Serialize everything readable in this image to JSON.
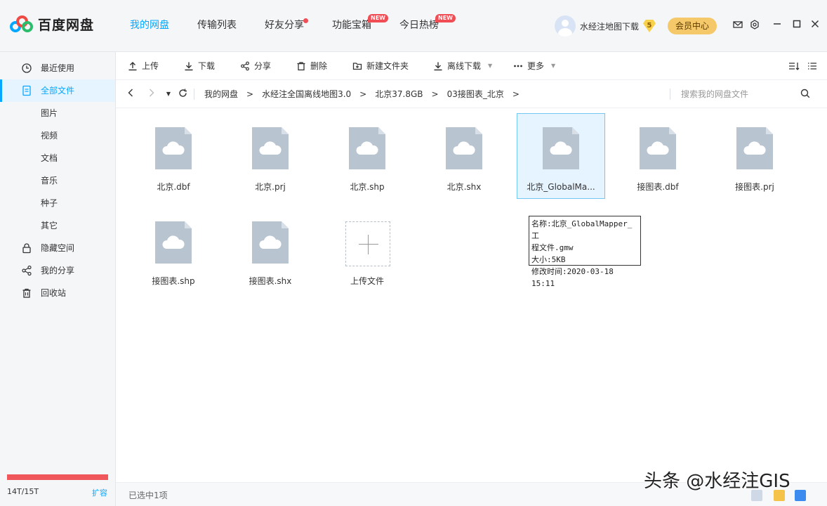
{
  "app": {
    "name": "百度网盘"
  },
  "nav": [
    {
      "label": "我的网盘",
      "active": true
    },
    {
      "label": "传输列表"
    },
    {
      "label": "好友分享",
      "dot": true
    },
    {
      "label": "功能宝箱",
      "badge": "NEW"
    },
    {
      "label": "今日热榜",
      "badge": "NEW"
    }
  ],
  "user": {
    "name": "水经注地图下载",
    "level": "5",
    "vip_label": "会员中心"
  },
  "sidebar": {
    "items": [
      {
        "label": "最近使用",
        "icon": "clock-icon"
      },
      {
        "label": "全部文件",
        "icon": "document-icon",
        "active": true
      },
      {
        "label": "图片"
      },
      {
        "label": "视频"
      },
      {
        "label": "文档"
      },
      {
        "label": "音乐"
      },
      {
        "label": "种子"
      },
      {
        "label": "其它"
      },
      {
        "label": "隐藏空间",
        "icon": "lock-icon"
      },
      {
        "label": "我的分享",
        "icon": "share-icon"
      },
      {
        "label": "回收站",
        "icon": "trash-icon"
      }
    ],
    "storage": "14T/15T",
    "expand_label": "扩容",
    "storage_used_fraction": 0.933
  },
  "toolbar": {
    "upload": "上传",
    "download": "下载",
    "share": "分享",
    "delete": "删除",
    "new_folder": "新建文件夹",
    "offline_download": "离线下载",
    "more": "更多"
  },
  "breadcrumb": [
    "我的网盘",
    "水经注全国离线地图3.0",
    "北京37.8GB",
    "03接图表_北京"
  ],
  "search": {
    "placeholder": "搜索我的网盘文件"
  },
  "files": [
    {
      "name": "北京.dbf"
    },
    {
      "name": "北京.prj"
    },
    {
      "name": "北京.shp"
    },
    {
      "name": "北京.shx"
    },
    {
      "name": "北京_GlobalMa...",
      "selected": true
    },
    {
      "name": "接图表.dbf"
    },
    {
      "name": "接图表.prj"
    },
    {
      "name": "接图表.shp"
    },
    {
      "name": "接图表.shx"
    }
  ],
  "upload_tile": {
    "label": "上传文件"
  },
  "tooltip": {
    "line1": "名称:北京_GlobalMapper_工",
    "line2": "程文件.gmw",
    "line3": "大小:5KB",
    "line4": "修改时间:2020-03-18 15:11"
  },
  "status": {
    "selected_text": "已选中1项"
  },
  "watermark": "头条 @水经注GIS",
  "colors": {
    "accent": "#06a7ff",
    "storage_bar": "#f0575a",
    "vip": "#f5c96a",
    "badge": "#f04d55"
  }
}
